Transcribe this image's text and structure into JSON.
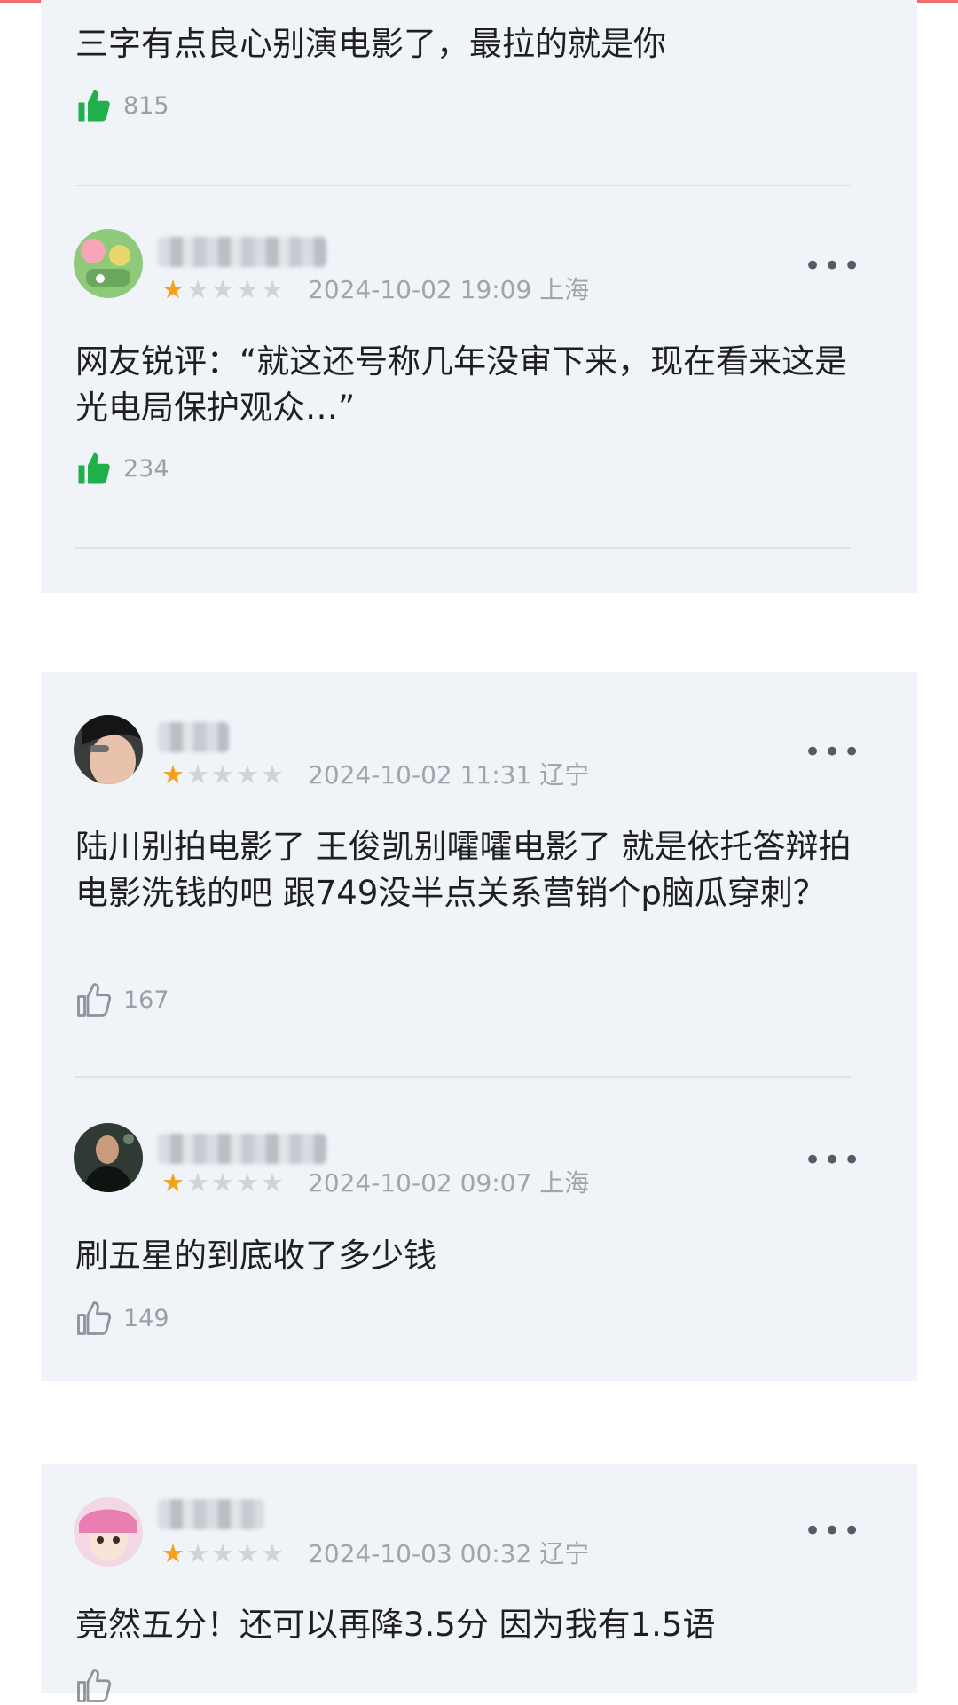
{
  "comments": [
    {
      "text": "三字有点良心别演电影了，最拉的就是你",
      "likes": "815",
      "liked": true
    },
    {
      "date": "2024-10-02 19:09",
      "location": "上海",
      "rating": 1,
      "text": "网友锐评：“就这还号称几年没审下来，现在看来这是光电局保护观众…”",
      "likes": "234",
      "liked": true,
      "more": "•••"
    },
    {
      "date": "2024-10-02 11:31",
      "location": "辽宁",
      "rating": 1,
      "text": "陆川别拍电影了 王俊凯别嚯嚯电影了 就是依托答辩拍电影洗钱的吧 跟749没半点关系营销个p脑瓜穿刺？",
      "likes": "167",
      "liked": false,
      "more": "•••"
    },
    {
      "date": "2024-10-02 09:07",
      "location": "上海",
      "rating": 1,
      "text": "刷五星的到底收了多少钱",
      "likes": "149",
      "liked": false,
      "more": "•••"
    },
    {
      "date": "2024-10-03 00:32",
      "location": "辽宁",
      "rating": 1,
      "text": "竟然五分！还可以再降3.5分  因为我有1.5语",
      "more": "•••"
    }
  ],
  "colors": {
    "card_bg": "#f0f4f9",
    "like_active": "#1fb04c",
    "like_inactive": "#8d939a",
    "star_active": "#f5a21b",
    "star_inactive": "#d0d4d9",
    "meta_text": "#a0a5ab"
  },
  "icons": {
    "like": "thumbs-up-icon",
    "star": "star-icon",
    "more": "more-dots-icon"
  }
}
